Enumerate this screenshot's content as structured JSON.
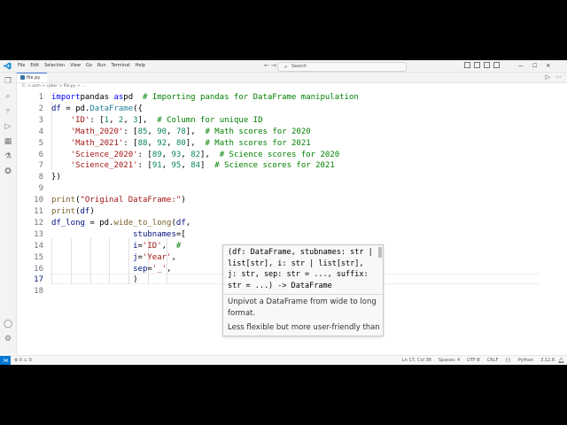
{
  "menu": [
    "File",
    "Edit",
    "Selection",
    "View",
    "Go",
    "Run",
    "Terminal",
    "Help"
  ],
  "nav_arrows": "← →",
  "search": {
    "label": "Search",
    "icon": "search-icon"
  },
  "tab": {
    "label": "file.py"
  },
  "breadcrumb": "C: > asm > cyber > file.py > ...",
  "run_icons": [
    "run-icon",
    "more-icon"
  ],
  "activity_icons": [
    "files-icon",
    "search-icon",
    "source-control-icon",
    "run-debug-icon",
    "extensions-icon",
    "testing-icon",
    "python-icon",
    "account-icon",
    "settings-gear-icon"
  ],
  "editor": {
    "line_numbers": [
      "1",
      "2",
      "3",
      "4",
      "5",
      "6",
      "7",
      "8",
      "9",
      "10",
      "11",
      "12",
      "13",
      "14",
      "15",
      "16",
      "17",
      "18"
    ],
    "current_line": "17"
  },
  "code_lines": [
    [
      [
        "kw",
        "import"
      ],
      [
        "",
        "pandas "
      ],
      [
        "kw",
        "as"
      ],
      [
        "",
        "pd  "
      ],
      [
        "cm",
        "# Importing pandas for DataFrame manipulation"
      ]
    ],
    [
      [
        "var",
        "df"
      ],
      [
        "",
        " = pd."
      ],
      [
        "cls",
        "DataFrame"
      ],
      [
        "",
        "({"
      ]
    ],
    [
      [
        "",
        "    "
      ],
      [
        "str",
        "'ID'"
      ],
      [
        "",
        ": ["
      ],
      [
        "num",
        "1"
      ],
      [
        "",
        ", "
      ],
      [
        "num",
        "2"
      ],
      [
        "",
        ", "
      ],
      [
        "num",
        "3"
      ],
      [
        "",
        "],  "
      ],
      [
        "cm",
        "# Column for unique ID"
      ]
    ],
    [
      [
        "",
        "    "
      ],
      [
        "str",
        "'Math_2020'"
      ],
      [
        "",
        ": ["
      ],
      [
        "num",
        "85"
      ],
      [
        "",
        ", "
      ],
      [
        "num",
        "90"
      ],
      [
        "",
        ", "
      ],
      [
        "num",
        "78"
      ],
      [
        "",
        "],  "
      ],
      [
        "cm",
        "# Math scores for 2020"
      ]
    ],
    [
      [
        "",
        "    "
      ],
      [
        "str",
        "'Math_2021'"
      ],
      [
        "",
        ": ["
      ],
      [
        "num",
        "88"
      ],
      [
        "",
        ", "
      ],
      [
        "num",
        "92"
      ],
      [
        "",
        ", "
      ],
      [
        "num",
        "80"
      ],
      [
        "",
        "],  "
      ],
      [
        "cm",
        "# Math scores for 2021"
      ]
    ],
    [
      [
        "",
        "    "
      ],
      [
        "str",
        "'Science_2020'"
      ],
      [
        "",
        ": ["
      ],
      [
        "num",
        "89"
      ],
      [
        "",
        ", "
      ],
      [
        "num",
        "93"
      ],
      [
        "",
        ", "
      ],
      [
        "num",
        "82"
      ],
      [
        "",
        "],  "
      ],
      [
        "cm",
        "# Science scores for 2020"
      ]
    ],
    [
      [
        "",
        "    "
      ],
      [
        "str",
        "'Science_2021'"
      ],
      [
        "",
        ": ["
      ],
      [
        "num",
        "91"
      ],
      [
        "",
        ", "
      ],
      [
        "num",
        "95"
      ],
      [
        "",
        ", "
      ],
      [
        "num",
        "84"
      ],
      [
        "",
        "]  "
      ],
      [
        "cm",
        "# Science scores for 2021"
      ]
    ],
    [
      [
        "",
        "})"
      ]
    ],
    [
      [
        "",
        ""
      ]
    ],
    [
      [
        "fn",
        "print"
      ],
      [
        "",
        "("
      ],
      [
        "str",
        "\"Original DataFrame:\""
      ],
      [
        "",
        ")"
      ]
    ],
    [
      [
        "fn",
        "print"
      ],
      [
        "",
        "("
      ],
      [
        "var",
        "df"
      ],
      [
        "",
        ")"
      ]
    ],
    [
      [
        "var",
        "df_long"
      ],
      [
        "",
        " = pd."
      ],
      [
        "fn",
        "wide_to_long"
      ],
      [
        "",
        "("
      ],
      [
        "var",
        "df"
      ],
      [
        "",
        ","
      ]
    ],
    [
      [
        "",
        "                 "
      ],
      [
        "var",
        "stubnames"
      ],
      [
        "",
        "=["
      ]
    ],
    [
      [
        "",
        "                 "
      ],
      [
        "var",
        "i"
      ],
      [
        "",
        "="
      ],
      [
        "str",
        "'ID'"
      ],
      [
        "",
        ",  "
      ],
      [
        "cm",
        "#"
      ]
    ],
    [
      [
        "",
        "                 "
      ],
      [
        "var",
        "j"
      ],
      [
        "",
        "="
      ],
      [
        "str",
        "'Year'"
      ],
      [
        "",
        ","
      ]
    ],
    [
      [
        "",
        "                 "
      ],
      [
        "var",
        "sep"
      ],
      [
        "",
        "="
      ],
      [
        "str",
        "'_'"
      ],
      [
        "",
        ","
      ]
    ],
    [
      [
        "",
        "                 )"
      ]
    ],
    [
      [
        "",
        ""
      ]
    ]
  ],
  "hover": {
    "signature": "(df: DataFrame, stubnames: str |\nlist[str], i: str | list[str],\nj: str, sep: str = ..., suffix:\nstr = ...) -> DataFrame",
    "doc": "Unpivot a DataFrame from wide to long format.",
    "doc2": "Less flexible but more user-friendly than"
  },
  "status": {
    "remote_icon": "remote-icon",
    "diagnostics": "⊗ 0 ⚠ 0",
    "position": "Ln 17, Col 38",
    "spaces": "Spaces: 4",
    "encoding": "UTF-8",
    "eol": "CRLF",
    "braces": "{}",
    "language": "Python",
    "version": "3.12.6",
    "bell_icon": "bell-icon"
  }
}
